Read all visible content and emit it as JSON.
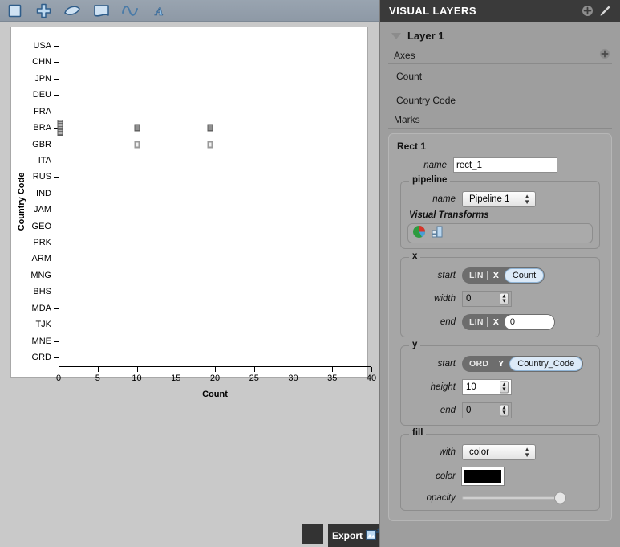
{
  "toolbar": {
    "tools": [
      {
        "name": "rect-tool",
        "icon": "square-icon"
      },
      {
        "name": "add-tool",
        "icon": "plus-icon"
      },
      {
        "name": "wedge-tool",
        "icon": "wedge-icon"
      },
      {
        "name": "area-tool",
        "icon": "area-icon"
      },
      {
        "name": "wave-tool",
        "icon": "wave-icon"
      },
      {
        "name": "text-tool",
        "icon": "text-a-icon"
      }
    ]
  },
  "chart_data": {
    "type": "scatter",
    "title": "",
    "xlabel": "Count",
    "ylabel": "Country Code",
    "xlim": [
      0,
      40
    ],
    "xticks": [
      0,
      5,
      10,
      15,
      20,
      25,
      30,
      35,
      40
    ],
    "categories": [
      "USA",
      "CHN",
      "JPN",
      "DEU",
      "FRA",
      "BRA",
      "GBR",
      "ITA",
      "RUS",
      "IND",
      "JAM",
      "GEO",
      "PRK",
      "ARM",
      "MNG",
      "BHS",
      "MDA",
      "TJK",
      "MNE",
      "GRD"
    ],
    "grid": false,
    "legend": null,
    "points": [
      {
        "x": 0.2,
        "y": "BRA",
        "style": "filled",
        "tall": true
      },
      {
        "x": 10.0,
        "y": "BRA",
        "style": "filled"
      },
      {
        "x": 10.0,
        "y": "GBR",
        "style": "hollow"
      },
      {
        "x": 19.4,
        "y": "BRA",
        "style": "filled"
      },
      {
        "x": 19.4,
        "y": "GBR",
        "style": "hollow"
      }
    ]
  },
  "export": {
    "label": "Export",
    "icon": "export-image-icon",
    "swatch_color": "#333333"
  },
  "panel": {
    "title": "VISUAL LAYERS",
    "add_icon": "plus-circle-icon",
    "edit_icon": "pencil-icon",
    "layer": {
      "name": "Layer 1",
      "caret": "caret-down-icon"
    },
    "axes": {
      "heading": "Axes",
      "add_icon": "plus-circle-icon",
      "items": [
        "Count",
        "Country Code"
      ]
    },
    "marks": {
      "heading": "Marks",
      "rect": {
        "title": "Rect 1",
        "name_label": "name",
        "name_value": "rect_1",
        "pipeline": {
          "legend": "pipeline",
          "name_label": "name",
          "name_value": "Pipeline 1",
          "visual_transforms_label": "Visual Transforms",
          "transform_icons": [
            "pie-chart-icon",
            "bar-chart-icon"
          ]
        },
        "x": {
          "legend": "x",
          "start_label": "start",
          "start_scale": "LIN",
          "start_axis": "X",
          "start_value": "Count",
          "width_label": "width",
          "width_value": "0",
          "end_label": "end",
          "end_scale": "LIN",
          "end_axis": "X",
          "end_value": "0"
        },
        "y": {
          "legend": "y",
          "start_label": "start",
          "start_scale": "ORD",
          "start_axis": "Y",
          "start_value": "Country_Code",
          "height_label": "height",
          "height_value": "10",
          "end_label": "end",
          "end_value": "0"
        },
        "fill": {
          "legend": "fill",
          "with_label": "with",
          "with_value": "color",
          "color_label": "color",
          "color_value": "#000000",
          "opacity_label": "opacity",
          "opacity_value": "100"
        }
      }
    }
  }
}
